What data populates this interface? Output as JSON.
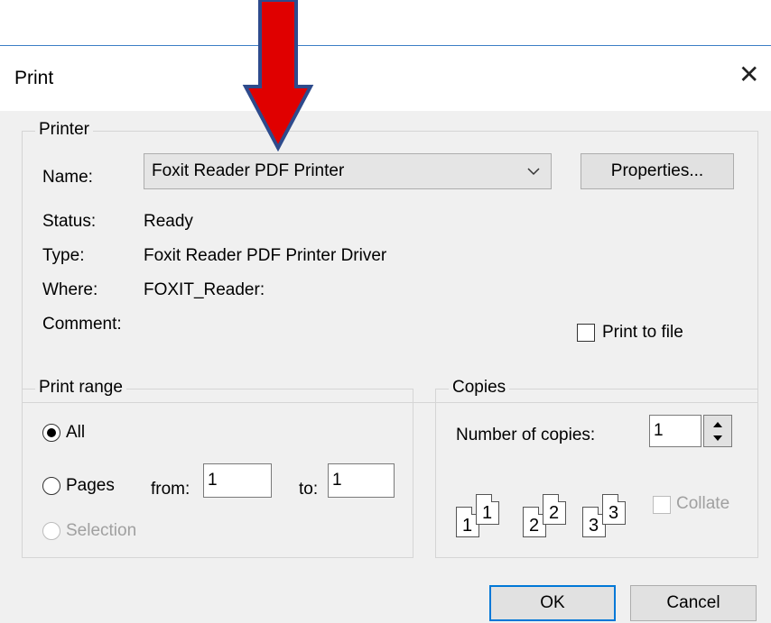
{
  "dialog": {
    "title": "Print",
    "close_glyph": "✕"
  },
  "printer": {
    "group_label": "Printer",
    "name_label": "Name:",
    "name_value": "Foxit Reader PDF Printer",
    "properties_label": "Properties...",
    "status_label": "Status:",
    "status_value": "Ready",
    "type_label": "Type:",
    "type_value": "Foxit Reader PDF Printer Driver",
    "where_label": "Where:",
    "where_value": "FOXIT_Reader:",
    "comment_label": "Comment:",
    "print_to_file_label": "Print to file"
  },
  "print_range": {
    "group_label": "Print range",
    "all_label": "All",
    "pages_label": "Pages",
    "from_label": "from:",
    "from_value": "1",
    "to_label": "to:",
    "to_value": "1",
    "selection_label": "Selection"
  },
  "copies": {
    "group_label": "Copies",
    "number_label": "Number of copies:",
    "number_value": "1",
    "collate_label": "Collate",
    "page_numbers": [
      "1",
      "1",
      "2",
      "2",
      "3",
      "3"
    ]
  },
  "buttons": {
    "ok": "OK",
    "cancel": "Cancel"
  },
  "annotation": {
    "arrow_color": "#e00000",
    "arrow_outline": "#2e4b8c"
  }
}
